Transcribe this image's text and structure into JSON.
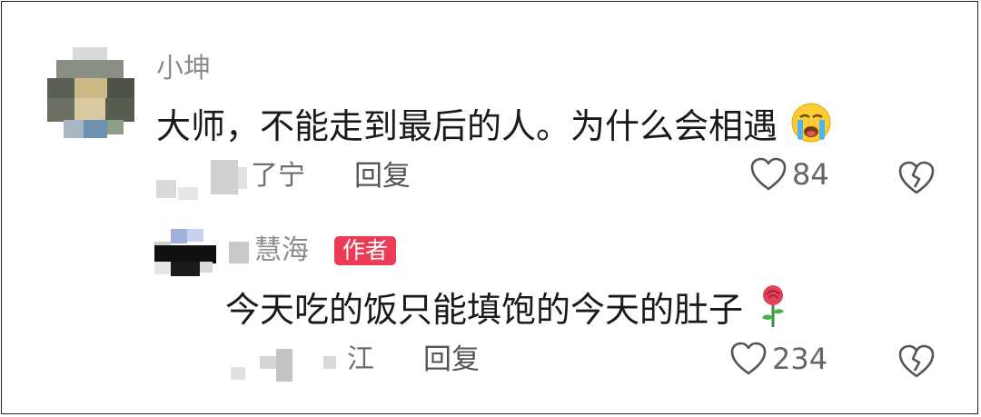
{
  "comment": {
    "username": "小坤",
    "text": "大师，不能走到最后的人。为什么会相遇",
    "emoji_icon": "crying-face-icon",
    "ip_location": "了宁",
    "reply_label": "回复",
    "like_count": "84"
  },
  "reply": {
    "username": "慧海",
    "author_badge": "作者",
    "text": "今天吃的饭只能填饱的今天的肚子",
    "emoji_icon": "rose-icon",
    "ip_location": "江",
    "reply_label": "回复",
    "like_count": "234"
  },
  "colors": {
    "badge_bg": "#ee3b55",
    "text": "#1a1a1a",
    "muted": "#8c8c8c"
  }
}
